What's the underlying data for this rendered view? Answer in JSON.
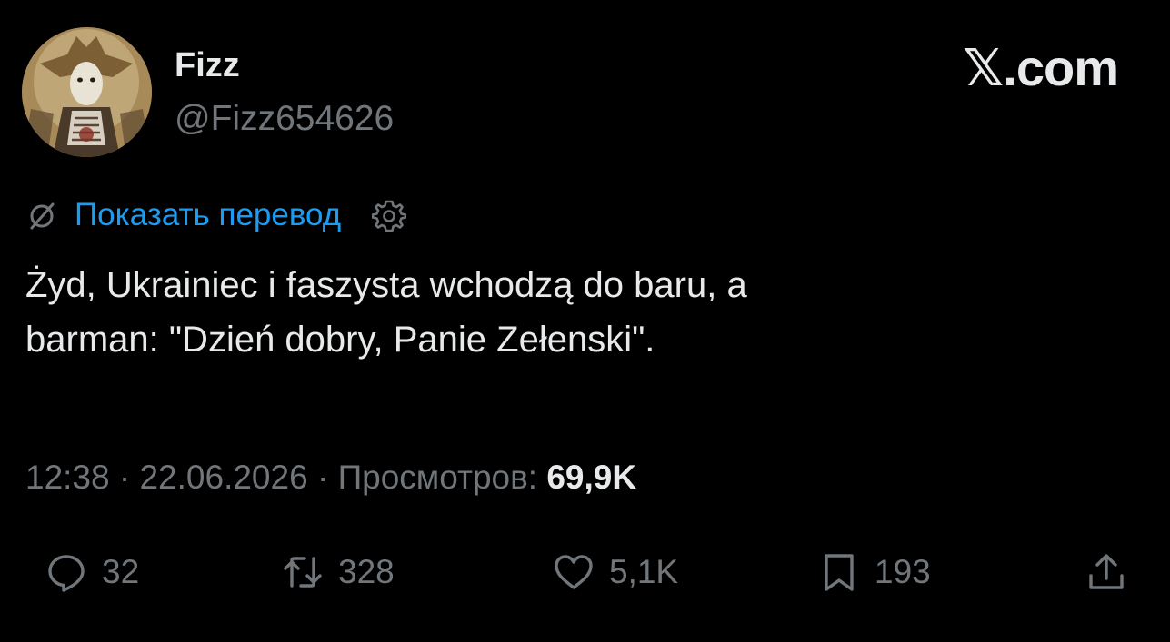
{
  "author": {
    "display_name": "Fizz",
    "handle": "@Fizz654626"
  },
  "brand": "𝕏.com",
  "translate": {
    "label": "Показать перевод",
    "icon": "globe-slash-icon",
    "settings_icon": "gear-icon"
  },
  "tweet": {
    "text_line1": "Żyd, Ukrainiec i faszysta wchodzą do baru, a",
    "text_line2": "barman: \"Dzień dobry, Panie Zełenski\"."
  },
  "meta": {
    "time": "12:38",
    "separator1": " · ",
    "date": "22.06.2026",
    "separator2": " · ",
    "views_label": "Просмотров: ",
    "views_count": "69,9K"
  },
  "actions": {
    "reply": {
      "icon": "reply-icon",
      "count": "32"
    },
    "retweet": {
      "icon": "retweet-icon",
      "count": "328"
    },
    "like": {
      "icon": "heart-icon",
      "count": "5,1K"
    },
    "bookmark": {
      "icon": "bookmark-icon",
      "count": "193"
    },
    "share": {
      "icon": "share-icon"
    }
  },
  "colors": {
    "background": "#000000",
    "primary_text": "#e7e9ea",
    "secondary_text": "#71767b",
    "link": "#1d9bf0"
  }
}
